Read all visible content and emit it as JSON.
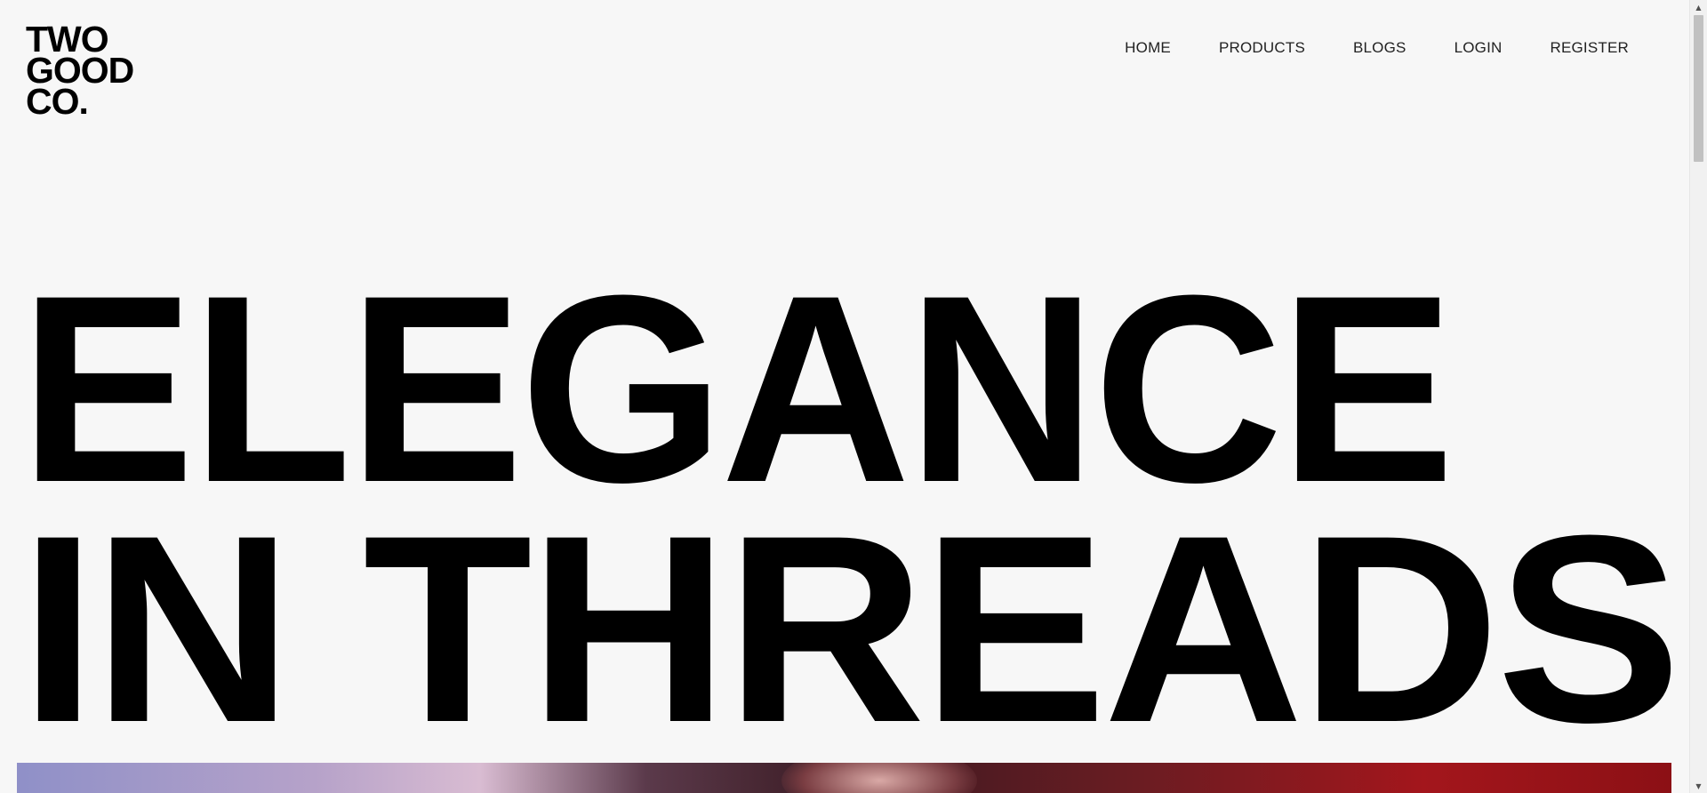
{
  "logo": {
    "line1": "TWO",
    "line2": "GOOD",
    "line3": "CO."
  },
  "nav": {
    "items": [
      {
        "label": "HOME"
      },
      {
        "label": "PRODUCTS"
      },
      {
        "label": "BLOGS"
      },
      {
        "label": "LOGIN"
      },
      {
        "label": "REGISTER"
      }
    ]
  },
  "hero": {
    "title_line1": "ELEGANCE",
    "title_line2": "IN THREADS"
  },
  "scrollbar": {
    "up_icon": "▲",
    "down_icon": "▼"
  }
}
